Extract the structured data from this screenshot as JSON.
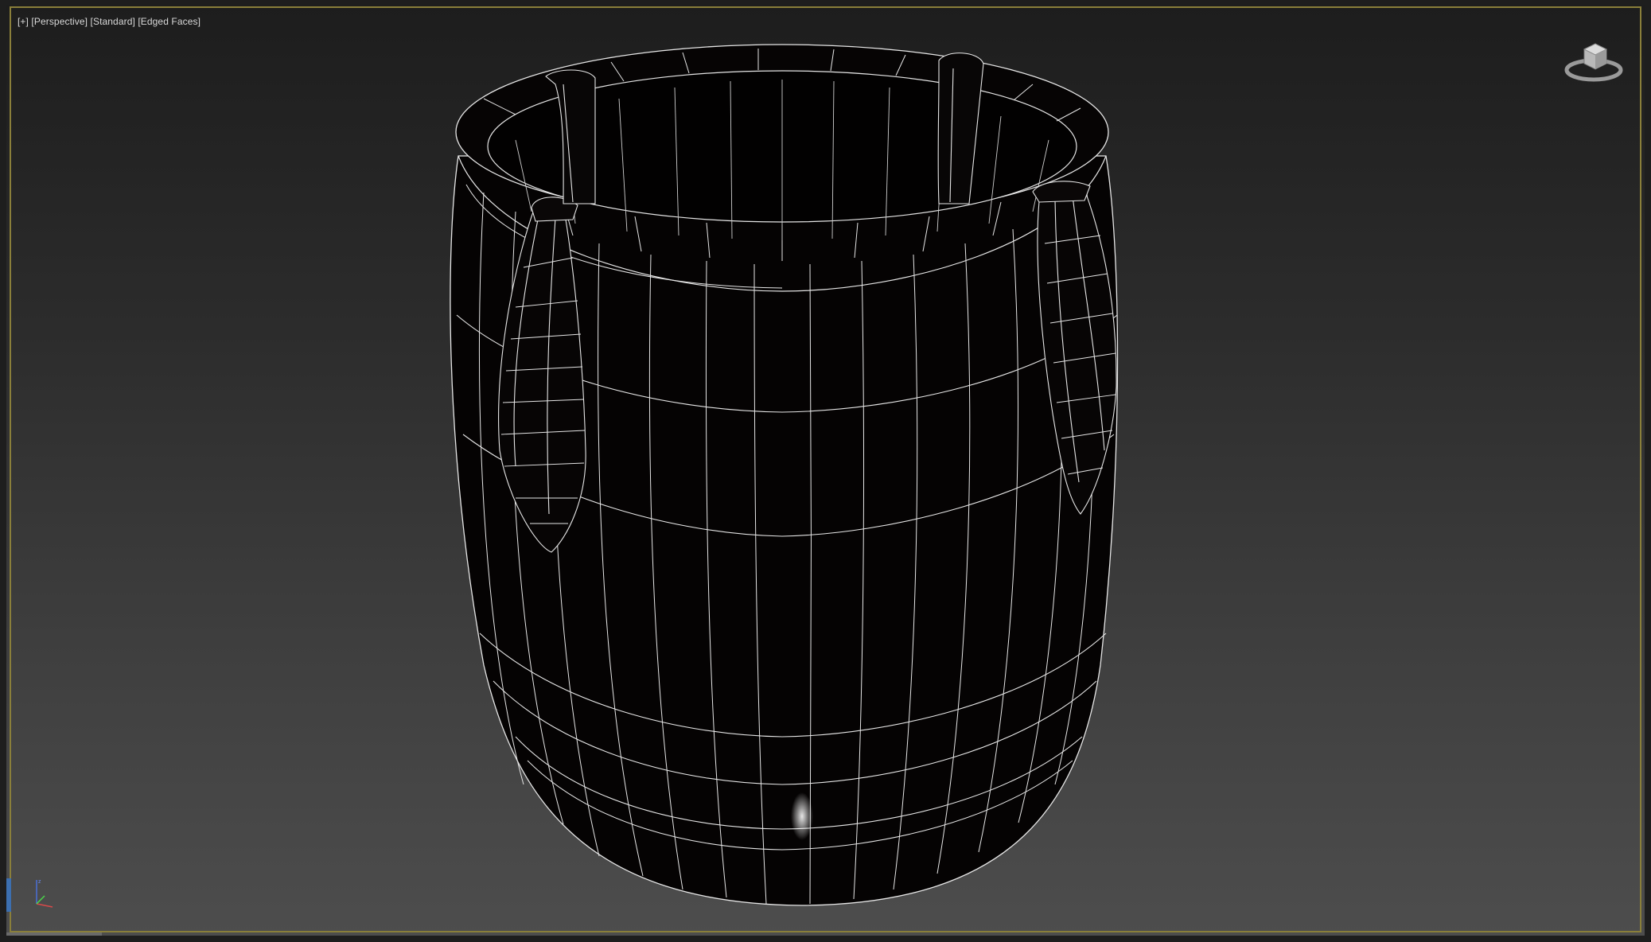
{
  "viewport": {
    "label_plus": "[+]",
    "label_view": "[Perspective]",
    "label_shading": "[Standard]",
    "label_mode": "[Edged Faces]"
  },
  "colors": {
    "frame_active": "#8a7f3a",
    "wire": "#e6e6e6",
    "mesh_fill": "#050303",
    "bg_top": "#1d1d1d",
    "bg_bottom": "#4d4d4d"
  },
  "icons": {
    "viewcube": "viewcube-icon",
    "axis": "axis-tripod-icon"
  }
}
